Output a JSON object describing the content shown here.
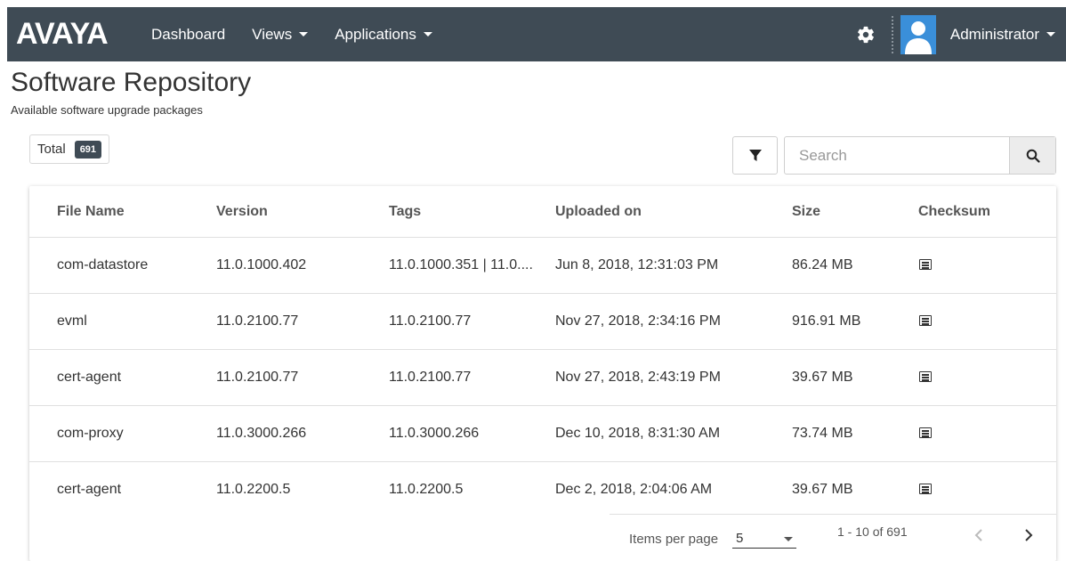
{
  "navbar": {
    "logo": "AVAYA",
    "items": [
      {
        "label": "Dashboard"
      },
      {
        "label": "Views"
      },
      {
        "label": "Applications"
      }
    ],
    "user": "Administrator"
  },
  "page": {
    "title": "Software Repository",
    "subtitle": "Available software upgrade packages"
  },
  "toolbar": {
    "total_label": "Total",
    "total_count": "691",
    "search_placeholder": "Search"
  },
  "table": {
    "columns": [
      "File Name",
      "Version",
      "Tags",
      "Uploaded on",
      "Size",
      "Checksum"
    ],
    "rows": [
      {
        "file": "com-datastore",
        "version": "11.0.1000.402",
        "tags": "11.0.1000.351 | 11.0....",
        "uploaded": "Jun 8, 2018, 12:31:03 PM",
        "size": "86.24 MB"
      },
      {
        "file": "evml",
        "version": "11.0.2100.77",
        "tags": "11.0.2100.77",
        "uploaded": "Nov 27, 2018, 2:34:16 PM",
        "size": "916.91 MB"
      },
      {
        "file": "cert-agent",
        "version": "11.0.2100.77",
        "tags": "11.0.2100.77",
        "uploaded": "Nov 27, 2018, 2:43:19 PM",
        "size": "39.67 MB"
      },
      {
        "file": "com-proxy",
        "version": "11.0.3000.266",
        "tags": "11.0.3000.266",
        "uploaded": "Dec 10, 2018, 8:31:30 AM",
        "size": "73.74 MB"
      },
      {
        "file": "cert-agent",
        "version": "11.0.2200.5",
        "tags": "11.0.2200.5",
        "uploaded": "Dec 2, 2018, 2:04:06 AM",
        "size": "39.67 MB"
      }
    ]
  },
  "pager": {
    "items_per_page_label": "Items per page",
    "items_per_page": "5",
    "range": "1 - 10 of 691"
  },
  "colors": {
    "navbar": "#3f4b55",
    "avatar": "#3a8fd9"
  }
}
